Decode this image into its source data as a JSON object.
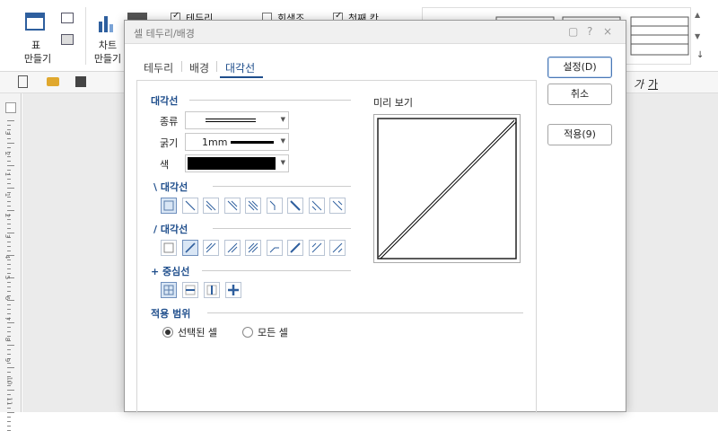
{
  "ribbon": {
    "table_label": "표",
    "table_sub": "만들기",
    "chart_label": "차트",
    "chart_sub": "만들기",
    "chk_border": "테두리",
    "chk_gray": "회색조",
    "chk_first": "첫째 칸",
    "font_btns": [
      "가",
      "가",
      "가"
    ]
  },
  "dialog": {
    "title": "셀 테두리/배경",
    "tabs": [
      "테두리",
      "배경",
      "대각선"
    ],
    "active_tab": "대각선",
    "section_diagonal": "대각선",
    "type_label": "종류",
    "width_label": "굵기",
    "width_value": "1mm",
    "color_label": "색",
    "color_value": "#000000",
    "backslash_section": "\\ 대각선",
    "slash_section": "/ 대각선",
    "center_section": "+ 중심선",
    "scope_section": "적용 범위",
    "scope_selected": "선택된 셀",
    "scope_all": "모든 셀",
    "preview_label": "미리 보기",
    "btn_set": "설정(D)",
    "btn_cancel": "취소",
    "btn_apply": "적용(9)"
  },
  "ruler_numbers": [
    "3",
    "2",
    "1",
    "1",
    "2",
    "3",
    "4",
    "5",
    "6",
    "7",
    "8",
    "9",
    "10",
    "11"
  ],
  "colors": {
    "accent": "#1f4e8c",
    "selected_bg": "#d9e6f5"
  }
}
